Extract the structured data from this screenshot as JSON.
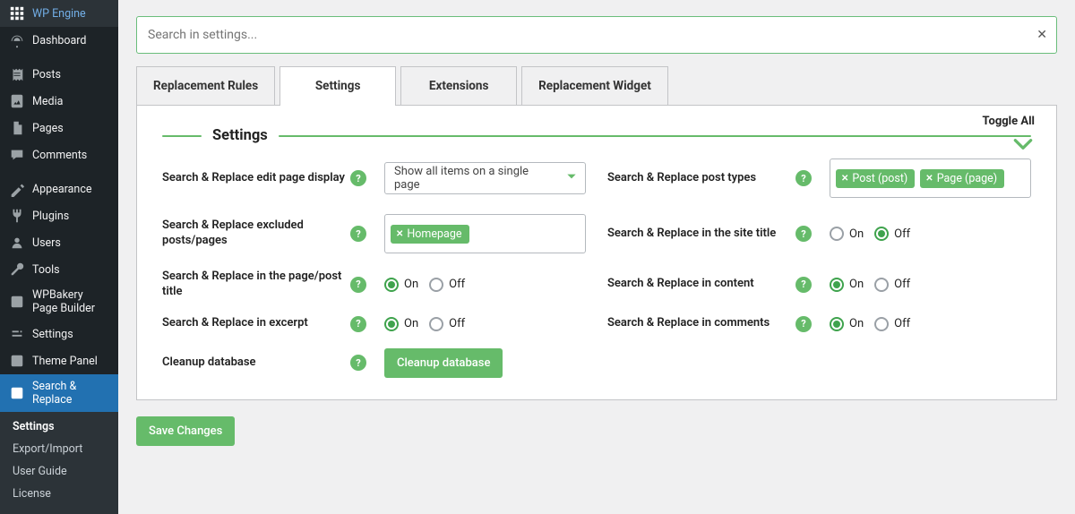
{
  "sidebar": {
    "items": [
      {
        "label": "WP Engine",
        "icon": "wpengine"
      },
      {
        "label": "Dashboard",
        "icon": "dashboard"
      },
      {
        "label": "Posts",
        "icon": "posts"
      },
      {
        "label": "Media",
        "icon": "media"
      },
      {
        "label": "Pages",
        "icon": "pages"
      },
      {
        "label": "Comments",
        "icon": "comments"
      },
      {
        "label": "Appearance",
        "icon": "appearance"
      },
      {
        "label": "Plugins",
        "icon": "plugins"
      },
      {
        "label": "Users",
        "icon": "users"
      },
      {
        "label": "Tools",
        "icon": "tools"
      },
      {
        "label": "WPBakery Page Builder",
        "icon": "wpbakery"
      },
      {
        "label": "Settings",
        "icon": "settings"
      },
      {
        "label": "Theme Panel",
        "icon": "themepanel"
      },
      {
        "label": "Search & Replace",
        "icon": "searchreplace",
        "active": true
      }
    ],
    "sub": [
      {
        "label": "Settings",
        "bold": true
      },
      {
        "label": "Export/Import"
      },
      {
        "label": "User Guide"
      },
      {
        "label": "License"
      }
    ]
  },
  "search": {
    "placeholder": "Search in settings..."
  },
  "tabs": [
    {
      "label": "Replacement Rules"
    },
    {
      "label": "Settings",
      "active": true
    },
    {
      "label": "Extensions"
    },
    {
      "label": "Replacement Widget"
    }
  ],
  "panel": {
    "toggle_all": "Toggle All",
    "section_title": "Settings",
    "rows": {
      "display": {
        "label": "Search & Replace edit page display",
        "select": "Show all items on a single page"
      },
      "posttypes": {
        "label": "Search & Replace post types",
        "tags": [
          "Post (post)",
          "Page (page)"
        ]
      },
      "excluded": {
        "label": "Search & Replace excluded posts/pages",
        "tags": [
          "Homepage"
        ]
      },
      "sitetitle": {
        "label": "Search & Replace in the site title",
        "on": "On",
        "off": "Off",
        "value": "Off"
      },
      "pagetitle": {
        "label": "Search & Replace in the page/post title",
        "on": "On",
        "off": "Off",
        "value": "On"
      },
      "content": {
        "label": "Search & Replace in content",
        "on": "On",
        "off": "Off",
        "value": "On"
      },
      "excerpt": {
        "label": "Search & Replace in excerpt",
        "on": "On",
        "off": "Off",
        "value": "On"
      },
      "comments": {
        "label": "Search & Replace in comments",
        "on": "On",
        "off": "Off",
        "value": "On"
      },
      "cleanup": {
        "label": "Cleanup database",
        "button": "Cleanup database"
      }
    }
  },
  "save_label": "Save Changes"
}
